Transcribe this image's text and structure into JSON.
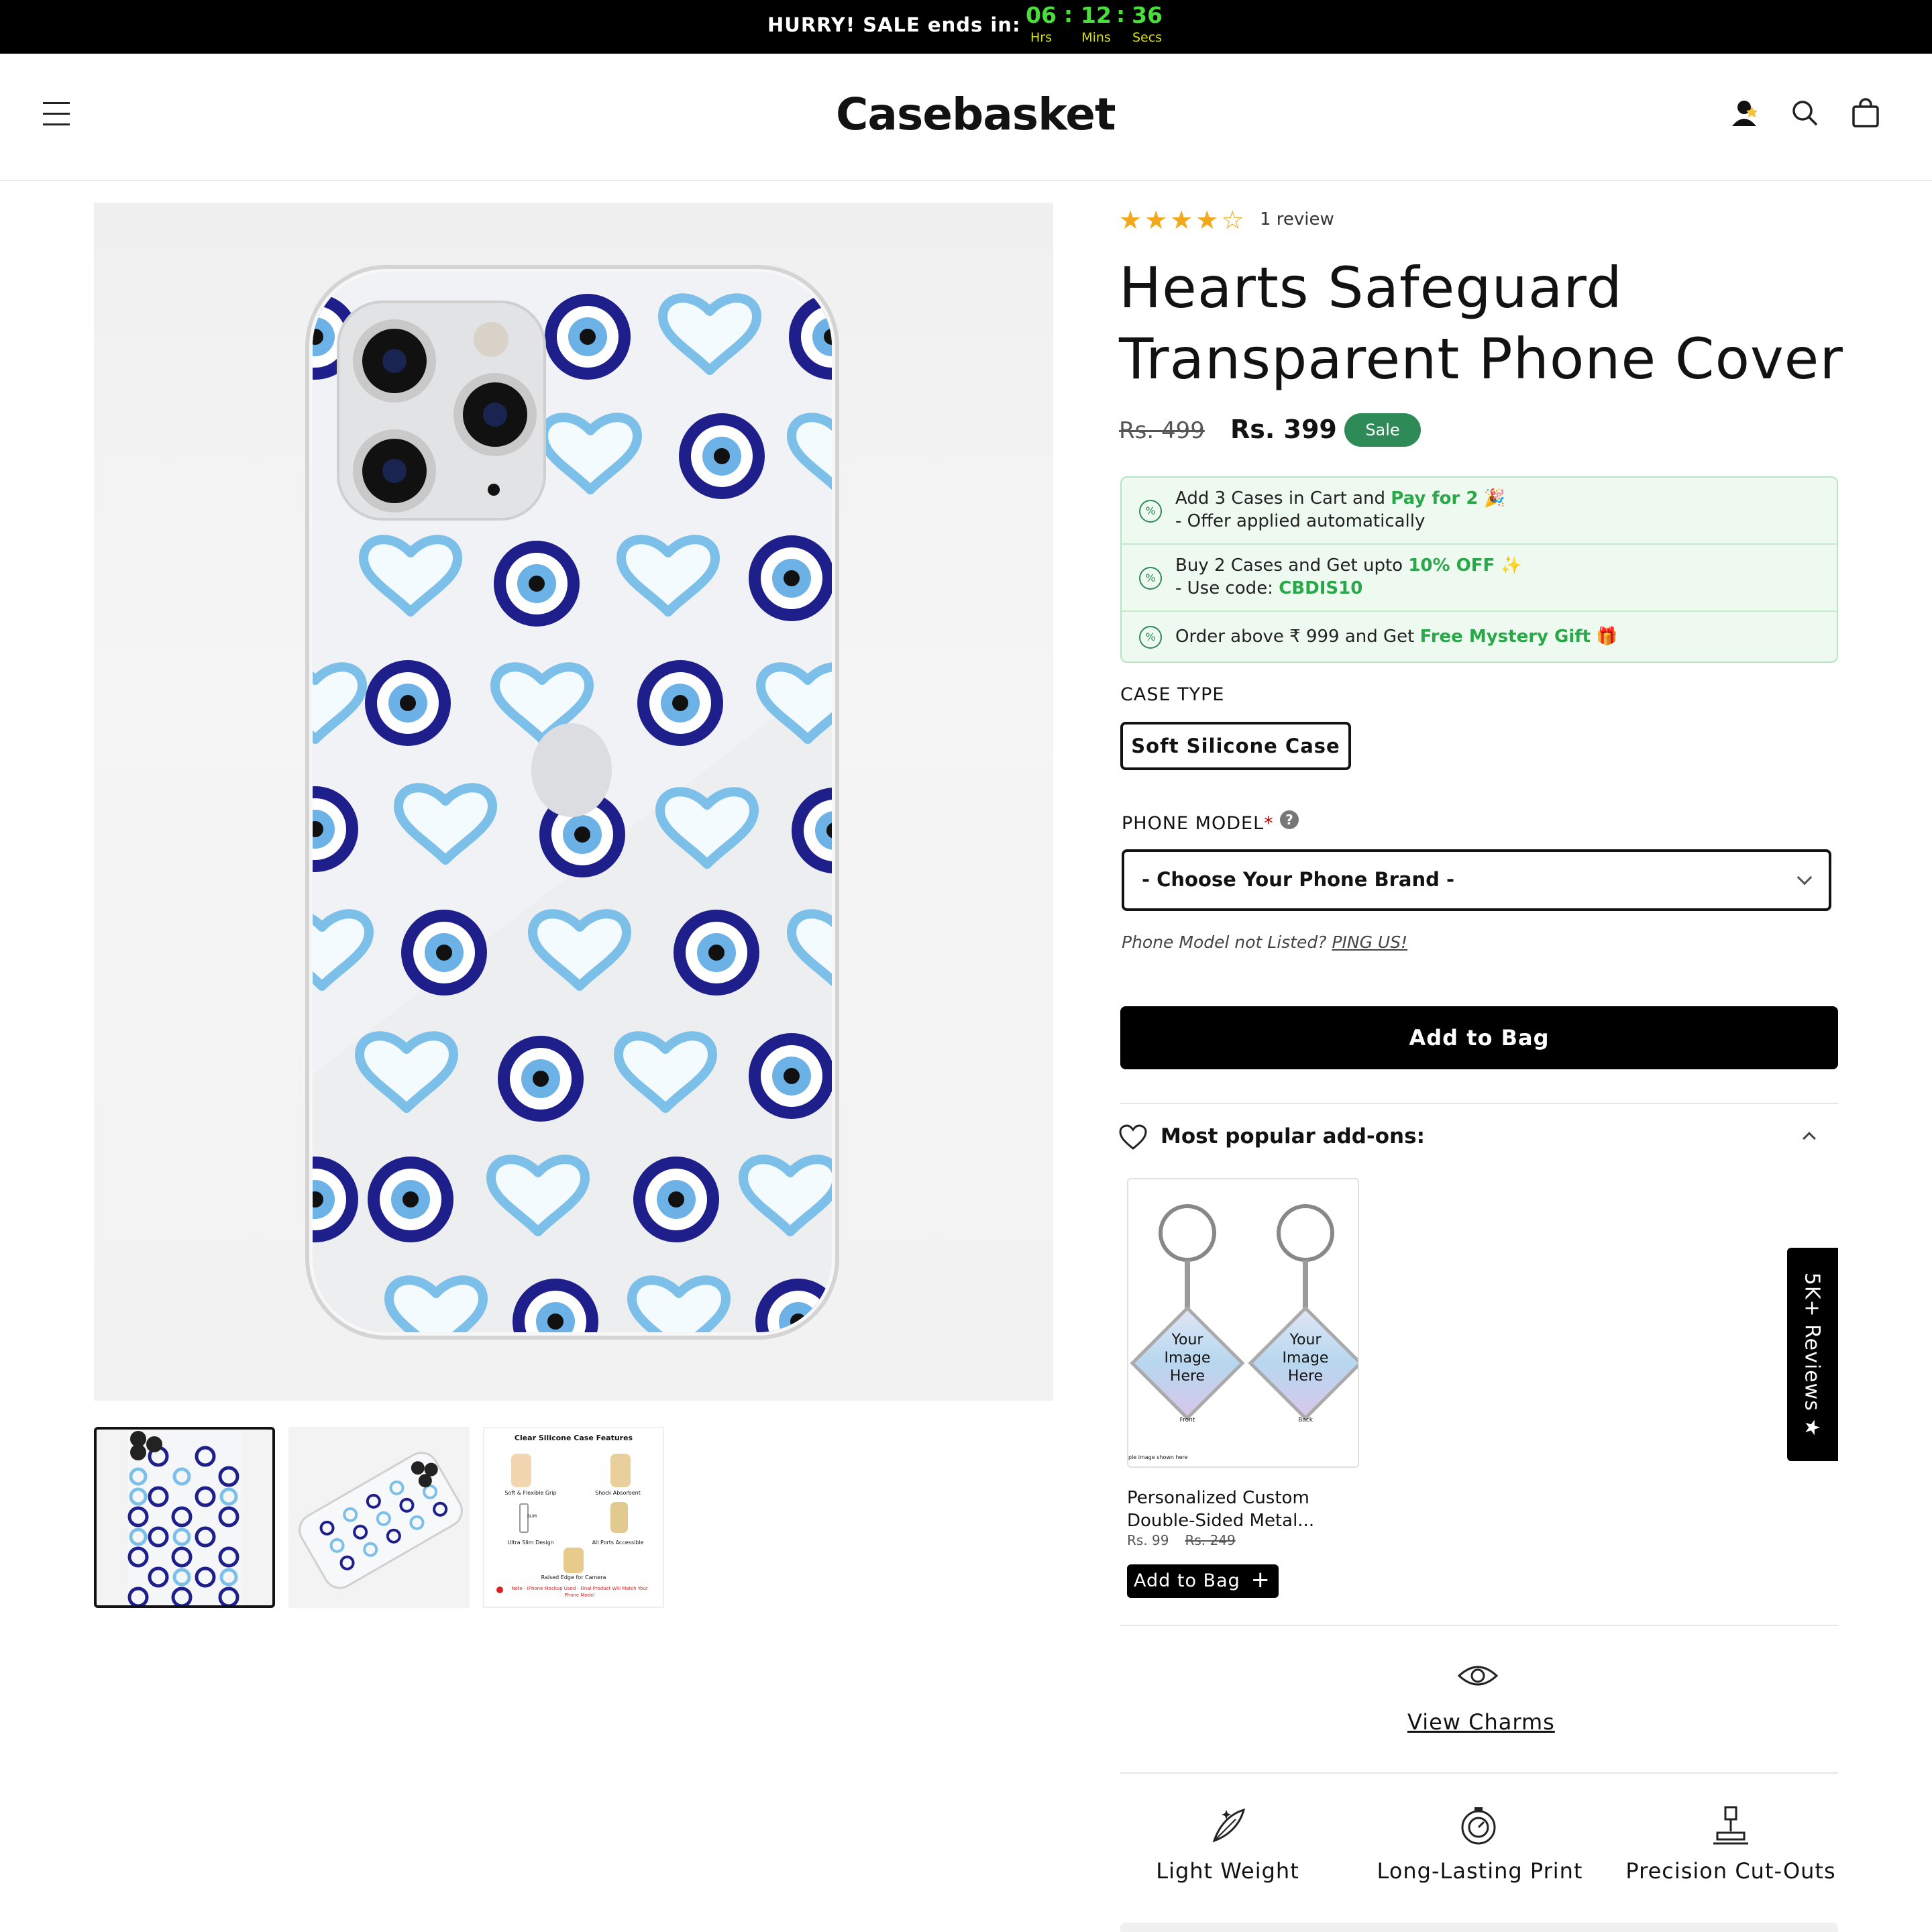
{
  "topbar": {
    "hurry": "HURRY! SALE ends in:",
    "hours": "06",
    "hours_label": "Hrs",
    "mins": "12",
    "mins_label": "Mins",
    "secs": "36",
    "secs_label": "Secs",
    "separator": ":"
  },
  "header": {
    "logo": "Casebasket",
    "icons": [
      "menu-icon",
      "account-icon",
      "search-icon",
      "cart-icon"
    ]
  },
  "gallery": {
    "thumb3_title": "Clear Silicone Case Features",
    "thumb3_items": [
      "Soft & Flexible Grip",
      "Shock Absorbent",
      "Ultra Slim Design",
      "All Ports Accessible",
      "Raised Edge for Camera"
    ],
    "thumb3_note": "Note - iPhone Mockup Used - Final Product Will Match Your Phone Model",
    "thumb3_slim": "SLIM"
  },
  "product": {
    "stars": "★★★★☆",
    "review_count": "1 review",
    "title": "Hearts Safeguard Transparent Phone Cover",
    "old_price": "Rs. 499",
    "price": "Rs. 399",
    "sale_badge": "Sale",
    "rating": 4
  },
  "offers": [
    {
      "text1": "Add 3 Cases in Cart and ",
      "highlight": "Pay for 2",
      "emoji": "🎉",
      "text2": "- Offer applied automatically"
    },
    {
      "text1": "Buy 2 Cases and Get upto ",
      "highlight": "10% OFF",
      "emoji": "✨",
      "text2": "- Use code: ",
      "code": "CBDIS10"
    },
    {
      "text1": "Order above ₹ 999 and Get ",
      "highlight": "Free Mystery Gift",
      "emoji": "🎁"
    }
  ],
  "offer_icon": "%",
  "case_type": {
    "label": "CASE TYPE",
    "selected": "Soft Silicone Case"
  },
  "phone_model": {
    "label": "PHONE MODEL",
    "required": "*",
    "help": "?",
    "select_value": "- Choose Your Phone Brand -",
    "not_listed": "Phone Model not Listed? ",
    "ping": "PING US!"
  },
  "add_to_bag": "Add to Bag",
  "addons": {
    "heading": "Most popular add-ons:",
    "card_text_front": "Your Image Here",
    "card_text_back": "Your Image Here",
    "front_label": "Front",
    "back_label": "Back",
    "sample_note": "ple image shown here",
    "title": "Personalized Custom Double-Sided Metal...",
    "price": "Rs. 99",
    "old_price": "Rs. 249",
    "button": "Add to Bag"
  },
  "view_charms": "View Charms",
  "features": [
    "Light Weight",
    "Long-Lasting Print",
    "Precision Cut-Outs"
  ],
  "reviews_tab": "5K+ Reviews ★",
  "colors": {
    "accent_green": "#29a84a",
    "sale_badge": "#2e8b57",
    "timer_green": "#4ade3a",
    "star": "#f2a81a",
    "evil_eye_dark": "#1f1f8c",
    "heart_blue": "#7cc0ea"
  }
}
